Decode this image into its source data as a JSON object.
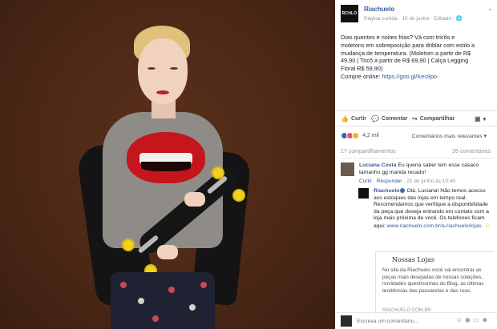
{
  "post": {
    "page_name": "Riachuelo",
    "avatar_text": "RCHLO",
    "meta": "Página curtida · 10 de junho · Editado · ",
    "body_lines": [
      "Dias quentes e noites frias? Vá com tricôs e",
      "moletons em sobreposição para driblar com estilo a",
      "mudança de temperatura. (Moletom a partir de R$",
      "49,90 | Tricô a partir de R$ 69,90 | Calça Legging",
      "Floral R$ 59,90)"
    ],
    "compre_label": "Compre online: ",
    "compre_link": "https://goo.gl/Kes9po"
  },
  "actions": {
    "like": "Curtir",
    "comment": "Comentar",
    "share": "Compartilhar"
  },
  "reactions": {
    "count": "4,2 mil",
    "sort": "Comentários mais relevantes ▾",
    "colors": [
      "#4267b2",
      "#f25268",
      "#f7b125"
    ]
  },
  "stats": {
    "shares": "17 compartilhamentos",
    "comments": "26 comentários"
  },
  "comment": {
    "author": "Luciana Costa",
    "text": " Eu queria saber tem esse casaco tamanho gg manda recado!",
    "like": "Curtir",
    "reply": "Responder",
    "time": " · 22 de junho às 10:40"
  },
  "reply": {
    "author": "Riachuelo",
    "text": " Olá, Luciana! Não temos acesso aos estoques das lojas em tempo real. Recomendamos que verifique a disponibilidade da peça que deseja entrando em contato com a loja mais próxima de você. Os telefones ficam aqui: ",
    "link": "www.riachuelo.com.br/a-riachuelo/lojas."
  },
  "preview": {
    "title": "Nossas Lojas",
    "body": "No site da Riachuelo você vai encontrar as peças mais desejadas de nossas coleções, novidades quentíssimas do Blog, as últimas tendências das passarelas e das ruas,",
    "domain": "RIACHUELO.COM.BR"
  },
  "composer": {
    "placeholder": "Escreva um comentário..."
  }
}
